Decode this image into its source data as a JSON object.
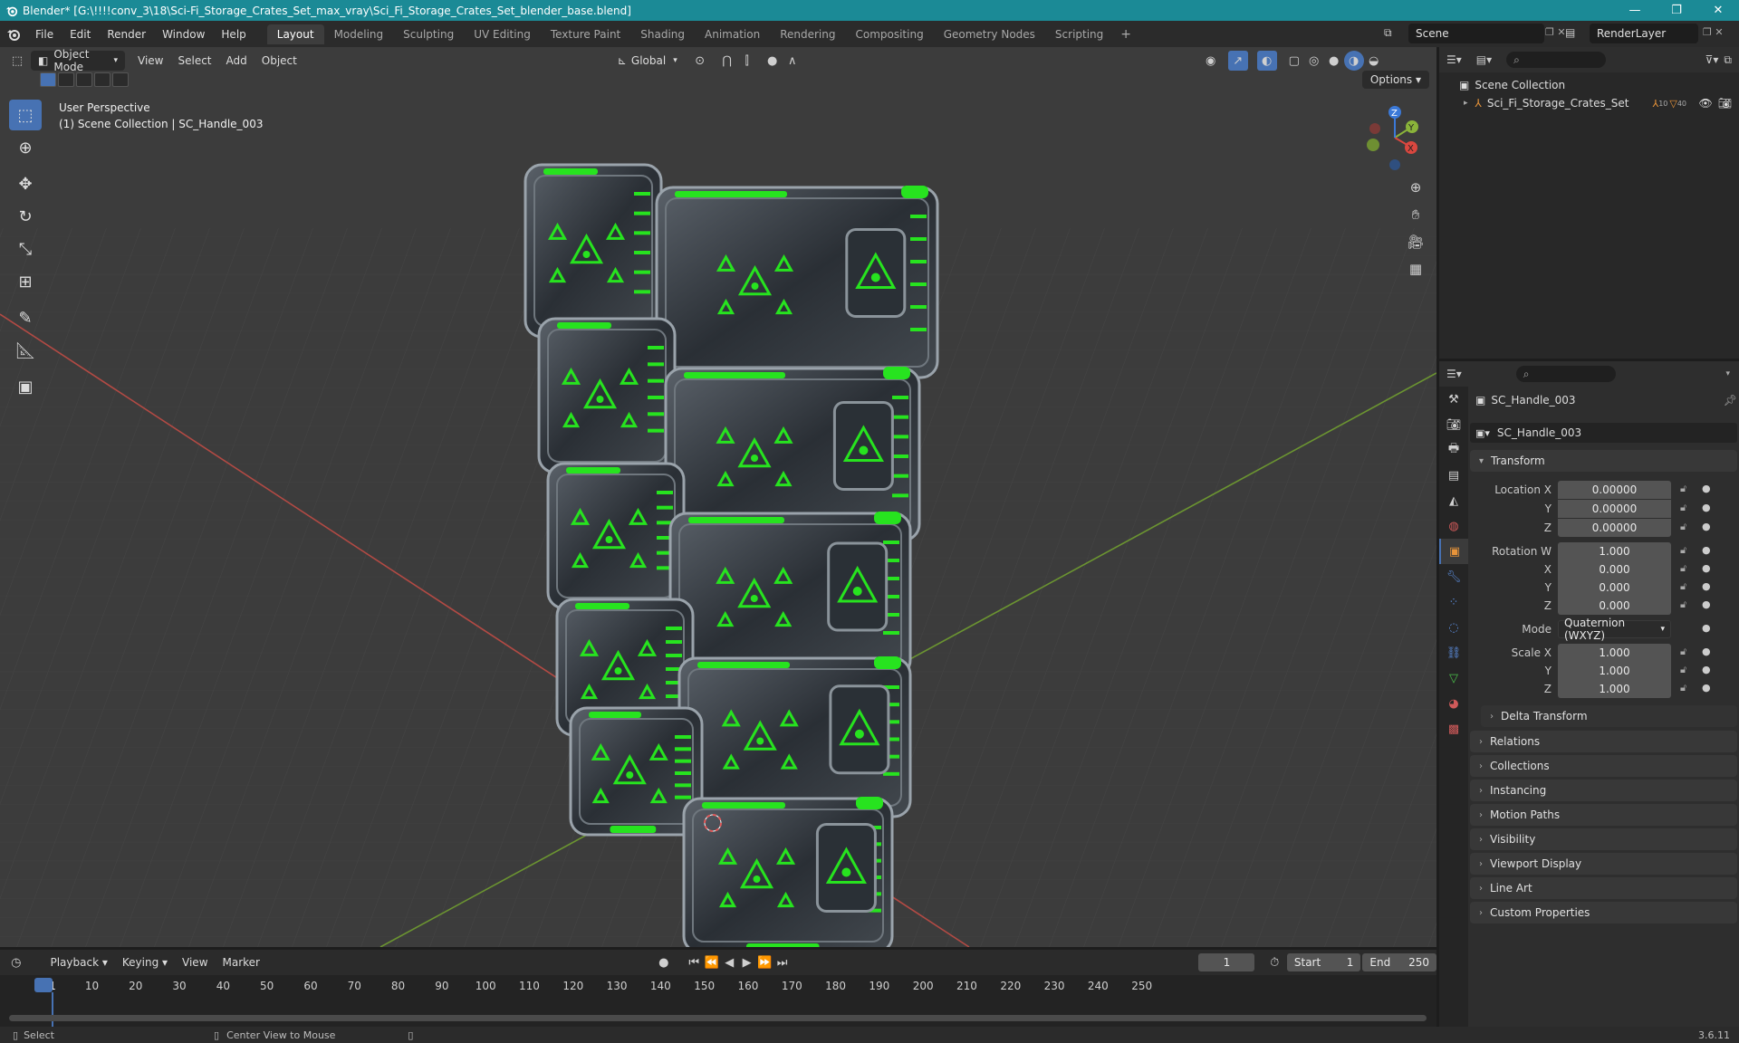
{
  "window": {
    "title": "Blender* [G:\\!!!!conv_3\\18\\Sci-Fi_Storage_Crates_Set_max_vray\\Sci_Fi_Storage_Crates_Set_blender_base.blend]",
    "minimize": "—",
    "maximize": "❐",
    "close": "✕"
  },
  "menu": {
    "items": [
      "File",
      "Edit",
      "Render",
      "Window",
      "Help"
    ],
    "workspaces": [
      "Layout",
      "Modeling",
      "Sculpting",
      "UV Editing",
      "Texture Paint",
      "Shading",
      "Animation",
      "Rendering",
      "Compositing",
      "Geometry Nodes",
      "Scripting"
    ],
    "active_workspace": "Layout",
    "add_workspace": "+",
    "scene": "Scene",
    "render_layer": "RenderLayer"
  },
  "viewport": {
    "mode": "Object Mode",
    "menus": [
      "View",
      "Select",
      "Add",
      "Object"
    ],
    "transform_orientation": "Global",
    "options_label": "Options",
    "info_line1": "User Perspective",
    "info_line2": "(1) Scene Collection | SC_Handle_003",
    "gizmo_axes": [
      "X",
      "Y",
      "Z"
    ]
  },
  "outliner": {
    "root": "Scene Collection",
    "items": [
      {
        "name": "Sci_Fi_Storage_Crates_Set",
        "badge1": "10",
        "badge2": "40"
      }
    ]
  },
  "properties": {
    "object_name": "SC_Handle_003",
    "data_name": "SC_Handle_003",
    "transform_label": "Transform",
    "location": {
      "label_x": "Location X",
      "label_y": "Y",
      "label_z": "Z",
      "x": "0.00000",
      "y": "0.00000",
      "z": "0.00000"
    },
    "rotation": {
      "label_w": "Rotation W",
      "label_x": "X",
      "label_y": "Y",
      "label_z": "Z",
      "w": "1.000",
      "x": "0.000",
      "y": "0.000",
      "z": "0.000"
    },
    "mode_label": "Mode",
    "mode_value": "Quaternion (WXYZ)",
    "scale": {
      "label_x": "Scale X",
      "label_y": "Y",
      "label_z": "Z",
      "x": "1.000",
      "y": "1.000",
      "z": "1.000"
    },
    "delta_transform": "Delta Transform",
    "panels": [
      "Relations",
      "Collections",
      "Instancing",
      "Motion Paths",
      "Visibility",
      "Viewport Display",
      "Line Art",
      "Custom Properties"
    ]
  },
  "timeline": {
    "menus": [
      "Playback",
      "Keying",
      "View",
      "Marker"
    ],
    "current_frame": "1",
    "start_label": "Start",
    "start": "1",
    "end_label": "End",
    "end": "250",
    "ruler": [
      "1",
      "10",
      "20",
      "30",
      "40",
      "50",
      "60",
      "70",
      "80",
      "90",
      "100",
      "110",
      "120",
      "130",
      "140",
      "150",
      "160",
      "170",
      "180",
      "190",
      "200",
      "210",
      "220",
      "230",
      "240",
      "250"
    ]
  },
  "status": {
    "select": "Select",
    "center": "Center View to Mouse",
    "version": "3.6.11"
  },
  "colors": {
    "accent": "#4772b3",
    "title_bar": "#1b8a96",
    "crate_glow": "#27e31f",
    "x_axis": "#c8463f",
    "y_axis": "#6e9a2c"
  }
}
